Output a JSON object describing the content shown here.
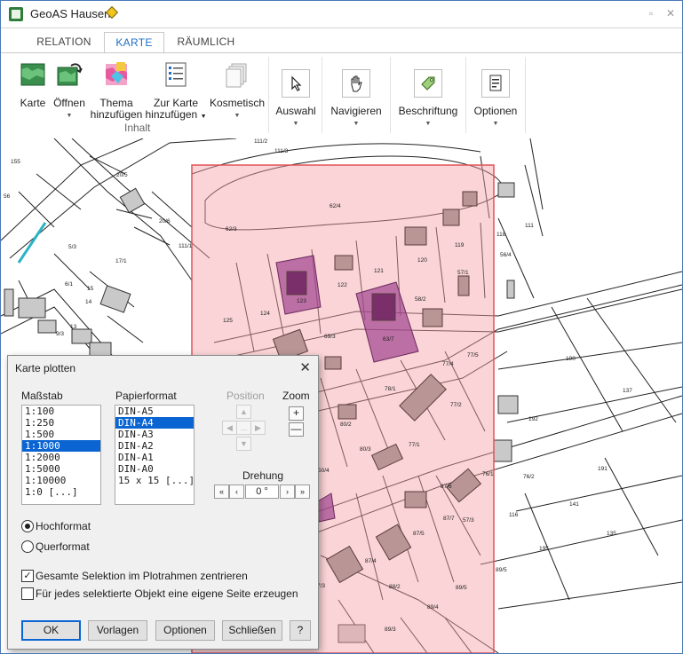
{
  "window": {
    "title": "GeoAS Hausen"
  },
  "tabs": [
    {
      "label": "RELATION"
    },
    {
      "label": "KARTE"
    },
    {
      "label": "RÄUMLICH"
    }
  ],
  "ribbon": {
    "karte": "Karte",
    "oeffnen": "Öffnen",
    "thema_line1": "Thema",
    "thema_line2": "hinzufügen",
    "zurkarte_line1": "Zur Karte",
    "zurkarte_line2": "hinzufügen",
    "kosmetisch": "Kosmetisch",
    "group_inhalt": "Inhalt",
    "auswahl": "Auswahl",
    "navigieren": "Navigieren",
    "beschriftung": "Beschriftung",
    "optionen": "Optionen"
  },
  "map": {
    "parcel_labels": [
      "111/2",
      "155",
      "111/3",
      "20/5",
      "62/4",
      "20/6",
      "62/3",
      "111/1",
      "17/1",
      "5/3",
      "6/1",
      "15",
      "14",
      "13",
      "9/3",
      "125",
      "124",
      "123",
      "122",
      "121",
      "120",
      "119",
      "118",
      "111",
      "56/4",
      "57/1",
      "58/2",
      "63/7",
      "69/3",
      "77/4",
      "77/5",
      "78/1",
      "77/2",
      "80/2",
      "77/1",
      "80/3",
      "87/6",
      "87/7",
      "87/5",
      "87/4",
      "88/2",
      "89/5",
      "89/4",
      "89/3",
      "76/1",
      "76/2",
      "190",
      "137",
      "192",
      "191",
      "141",
      "135",
      "195",
      "89/5",
      "7/3",
      "50/4",
      "116",
      "57/3",
      "56"
    ]
  },
  "dialog": {
    "title": "Karte plotten",
    "massstab_label": "Maßstab",
    "massstab_items": [
      "1:100",
      "1:250",
      "1:500",
      "1:1000",
      "1:2000",
      "1:5000",
      "1:10000",
      "1:0 [...]"
    ],
    "massstab_selected_index": 3,
    "papierformat_label": "Papierformat",
    "papierformat_items": [
      "DIN-A5",
      "DIN-A4",
      "DIN-A3",
      "DIN-A2",
      "DIN-A1",
      "DIN-A0",
      "15 x 15 [...]"
    ],
    "papierformat_selected_index": 1,
    "position_label": "Position",
    "position_center": "...",
    "zoom_label": "Zoom",
    "zoom_plus": "+",
    "zoom_minus": "—",
    "drehung_label": "Drehung",
    "rotation_value": "0 °",
    "rot_first": "«",
    "rot_prev": "‹",
    "rot_next": "›",
    "rot_last": "»",
    "orientation_portrait": "Hochformat",
    "orientation_landscape": "Querformat",
    "orientation_selected": "Hochformat",
    "center_selection_label": "Gesamte Selektion im Plotrahmen zentrieren",
    "center_selection_checked": true,
    "own_page_label": "Für jedes selektierte Objekt eine eigene Seite erzeugen",
    "own_page_checked": false,
    "btn_ok": "OK",
    "btn_vorlagen": "Vorlagen",
    "btn_optionen": "Optionen",
    "btn_schliessen": "Schließen",
    "btn_help": "?"
  }
}
